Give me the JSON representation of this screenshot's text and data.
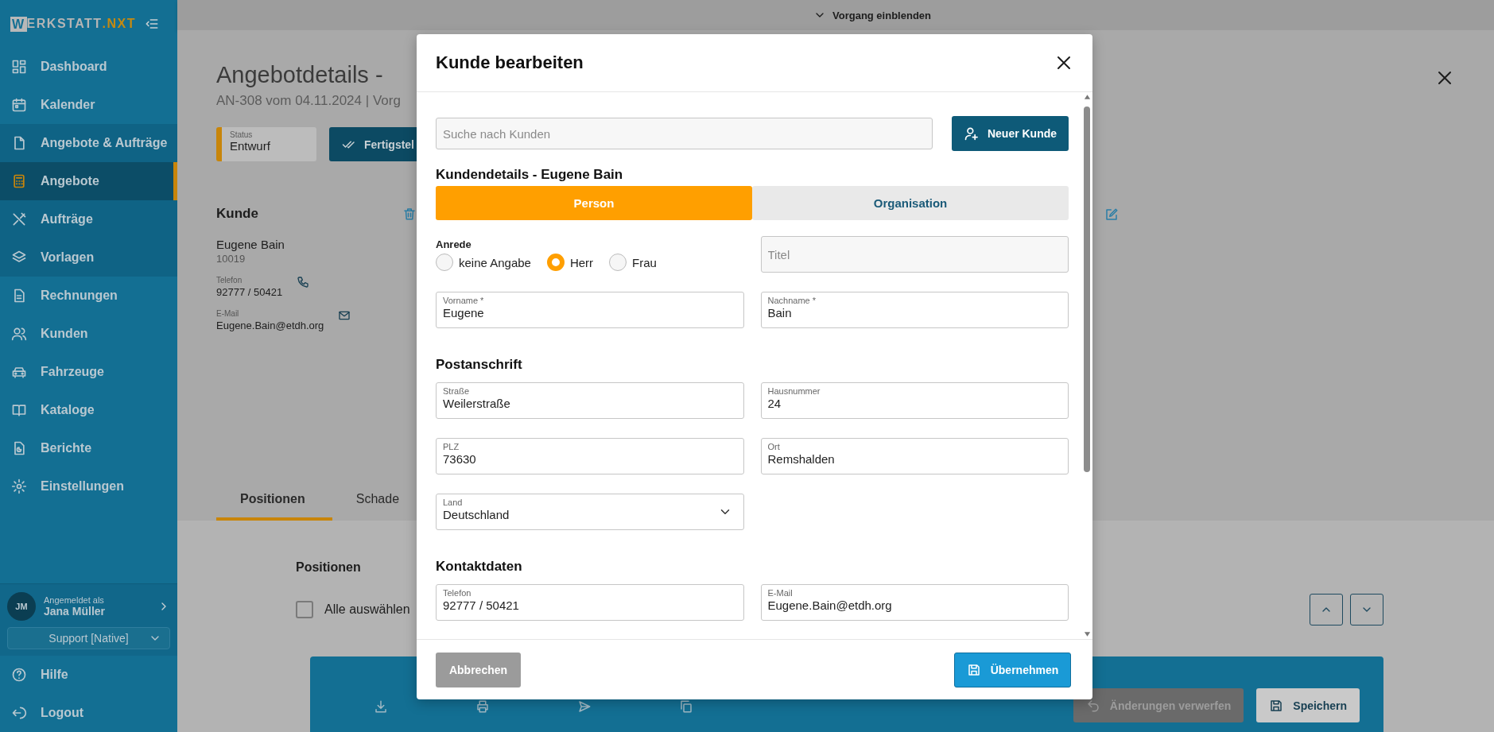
{
  "topbar": {
    "toggle_label": "Vorgang einblenden"
  },
  "sidebar": {
    "logo": {
      "mark": "W",
      "text": "ERKSTATT",
      "accent": ".NXT"
    },
    "items": [
      {
        "label": "Dashboard",
        "selected": false
      },
      {
        "label": "Kalender",
        "selected": false
      },
      {
        "label": "Angebote & Aufträge",
        "selected": false,
        "expanded": true,
        "children": [
          {
            "label": "Angebote",
            "selected": true
          },
          {
            "label": "Aufträge",
            "selected": false
          },
          {
            "label": "Vorlagen",
            "selected": false
          }
        ]
      },
      {
        "label": "Rechnungen",
        "selected": false
      },
      {
        "label": "Kunden",
        "selected": false
      },
      {
        "label": "Fahrzeuge",
        "selected": false
      },
      {
        "label": "Kataloge",
        "selected": false
      },
      {
        "label": "Berichte",
        "selected": false
      },
      {
        "label": "Einstellungen",
        "selected": false
      }
    ],
    "user": {
      "initials": "JM",
      "caption": "Angemeldet als",
      "name": "Jana Müller"
    },
    "role_select": {
      "value": "Support [Native]"
    },
    "footer_items": [
      {
        "label": "Hilfe"
      },
      {
        "label": "Logout"
      }
    ]
  },
  "page": {
    "title": "Angebotdetails -",
    "subtitle": "AN-308 vom 04.11.2024 | Vorg",
    "status": {
      "label": "Status",
      "value": "Entwurf"
    },
    "finish_button": "Fertigstel",
    "customer": {
      "heading": "Kunde",
      "name": "Eugene Bain",
      "number": "10019",
      "phone_label": "Telefon",
      "phone": "92777 / 50421",
      "email_label": "E-Mail",
      "email": "Eugene.Bain@etdh.org"
    },
    "tabs": [
      {
        "label": "Positionen",
        "selected": true
      },
      {
        "label": "Schade",
        "selected": false
      }
    ],
    "positions": {
      "heading": "Positionen",
      "select_all": {
        "label": "Alle auswählen",
        "checked": false
      }
    }
  },
  "bottom_bar": {
    "buttons": [
      {
        "label": "Änderungen verwerfen",
        "disabled": true
      },
      {
        "label": "Speichern",
        "disabled": false
      }
    ]
  },
  "dialog": {
    "title": "Kunde bearbeiten",
    "search": {
      "placeholder": "Suche nach Kunden"
    },
    "new_button": "Neuer Kunde",
    "details_heading": "Kundendetails - Eugene Bain",
    "type_options": [
      {
        "label": "Person",
        "selected": true
      },
      {
        "label": "Organisation",
        "selected": false
      }
    ],
    "salutation": {
      "label": "Anrede",
      "options": [
        {
          "label": "keine Angabe",
          "selected": false
        },
        {
          "label": "Herr",
          "selected": true
        },
        {
          "label": "Frau",
          "selected": false
        }
      ]
    },
    "title_field": {
      "placeholder": "Titel"
    },
    "name_fields": [
      {
        "label": "Vorname *",
        "value": "Eugene"
      },
      {
        "label": "Nachname *",
        "value": "Bain"
      }
    ],
    "address": {
      "heading": "Postanschrift",
      "fields": [
        {
          "kind": "text",
          "label": "Straße",
          "value": "Weilerstraße"
        },
        {
          "kind": "text",
          "label": "Hausnummer",
          "value": "24"
        },
        {
          "kind": "text",
          "label": "PLZ",
          "value": "73630"
        },
        {
          "kind": "text",
          "label": "Ort",
          "value": "Remshalden"
        },
        {
          "kind": "select",
          "label": "Land",
          "value": "Deutschland"
        }
      ]
    },
    "contact": {
      "heading": "Kontaktdaten",
      "fields": [
        {
          "kind": "text",
          "label": "Telefon",
          "value": "92777 / 50421"
        },
        {
          "kind": "text",
          "label": "E-Mail",
          "value": "Eugene.Bain@etdh.org"
        }
      ]
    },
    "cancel_button": "Abbrechen",
    "apply_button": "Übernehmen"
  }
}
